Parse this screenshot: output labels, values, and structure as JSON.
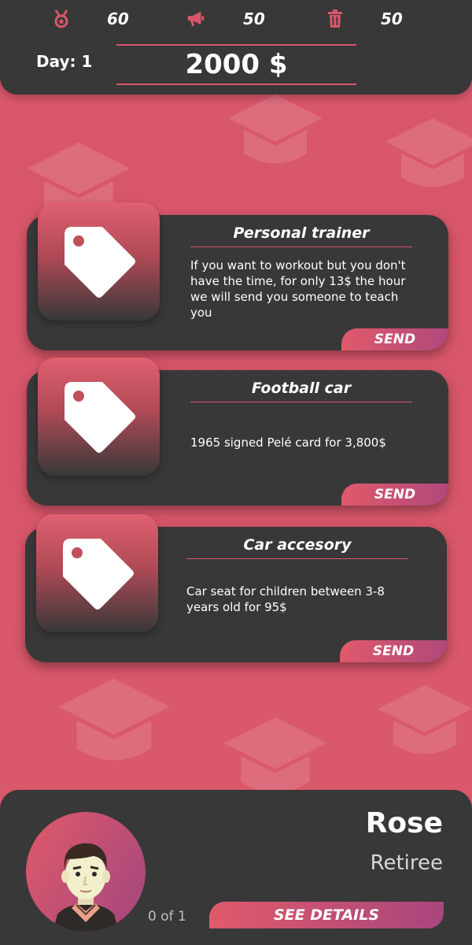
{
  "header": {
    "stats": [
      {
        "icon": "medal-icon",
        "value": "60"
      },
      {
        "icon": "megaphone-icon",
        "value": "50"
      },
      {
        "icon": "trash-icon",
        "value": "50"
      }
    ],
    "day_label": "Day: 1",
    "money": "2000 $"
  },
  "offers": [
    {
      "title": "Personal trainer",
      "description": "If you want to workout but you don't have the time, for only 13$ the hour we will send you someone to teach you",
      "button": "SEND",
      "icon": "price-tag-icon"
    },
    {
      "title": "Football car",
      "description": "1965 signed Pelé card for 3,800$",
      "button": "SEND",
      "icon": "price-tag-icon"
    },
    {
      "title": "Car accesory",
      "description": "Car seat for children between 3-8 years old for 95$",
      "button": "SEND",
      "icon": "price-tag-icon"
    }
  ],
  "character": {
    "name": "Rose",
    "role": "Retiree",
    "pager": "0 of 1",
    "details_button": "SEE DETAILS",
    "avatar": "character-avatar"
  },
  "colors": {
    "accent": "#d9576a",
    "panel": "#383838",
    "gradient_end": "#a8467e"
  }
}
